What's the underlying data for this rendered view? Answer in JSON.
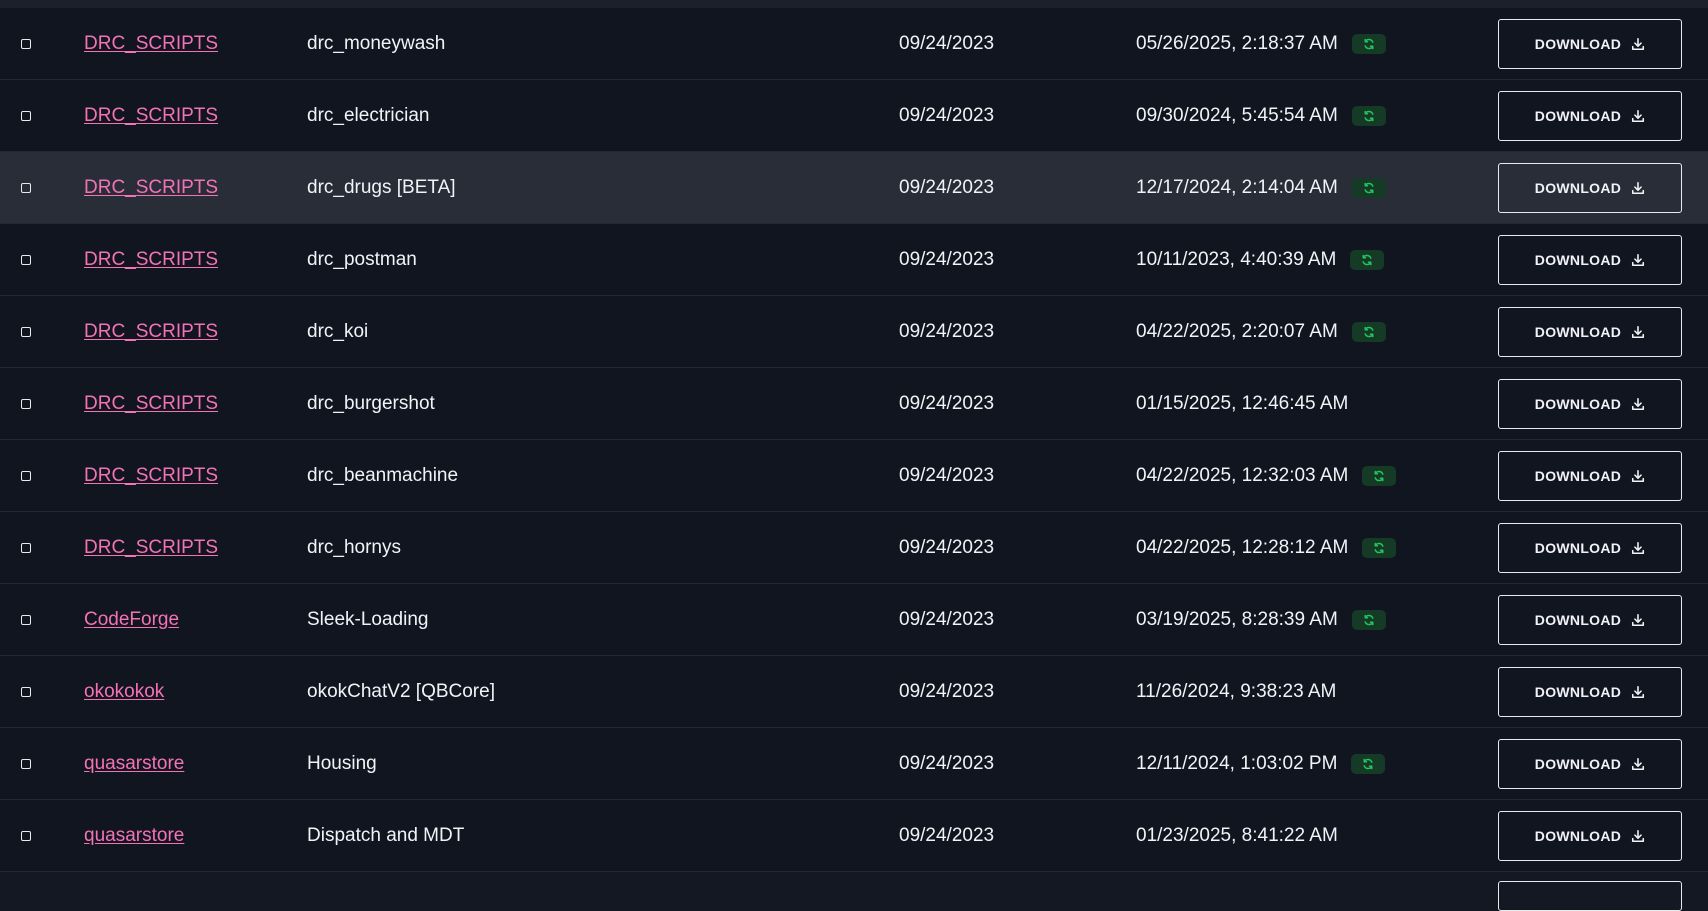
{
  "table": {
    "download_label": "DOWNLOAD",
    "rows": [
      {
        "author": "DRC_SCRIPTS",
        "name": "drc_moneywash",
        "created": "09/24/2023",
        "updated": "05/26/2025, 2:18:37 AM",
        "badge": true
      },
      {
        "author": "DRC_SCRIPTS",
        "name": "drc_electrician",
        "created": "09/24/2023",
        "updated": "09/30/2024, 5:45:54 AM",
        "badge": true
      },
      {
        "author": "DRC_SCRIPTS",
        "name": "drc_drugs [BETA]",
        "created": "09/24/2023",
        "updated": "12/17/2024, 2:14:04 AM",
        "badge": true,
        "hover": true
      },
      {
        "author": "DRC_SCRIPTS",
        "name": "drc_postman",
        "created": "09/24/2023",
        "updated": "10/11/2023, 4:40:39 AM",
        "badge": true
      },
      {
        "author": "DRC_SCRIPTS",
        "name": "drc_koi",
        "created": "09/24/2023",
        "updated": "04/22/2025, 2:20:07 AM",
        "badge": true
      },
      {
        "author": "DRC_SCRIPTS",
        "name": "drc_burgershot",
        "created": "09/24/2023",
        "updated": "01/15/2025, 12:46:45 AM",
        "badge": false
      },
      {
        "author": "DRC_SCRIPTS",
        "name": "drc_beanmachine",
        "created": "09/24/2023",
        "updated": "04/22/2025, 12:32:03 AM",
        "badge": true
      },
      {
        "author": "DRC_SCRIPTS",
        "name": "drc_hornys",
        "created": "09/24/2023",
        "updated": "04/22/2025, 12:28:12 AM",
        "badge": true
      },
      {
        "author": "CodeForge",
        "name": "Sleek-Loading",
        "created": "09/24/2023",
        "updated": "03/19/2025, 8:28:39 AM",
        "badge": true
      },
      {
        "author": "okokokok",
        "name": "okokChatV2 [QBCore]",
        "created": "09/24/2023",
        "updated": "11/26/2024, 9:38:23 AM",
        "badge": false
      },
      {
        "author": "quasarstore",
        "name": "Housing",
        "created": "09/24/2023",
        "updated": "12/11/2024, 1:03:02 PM",
        "badge": true
      },
      {
        "author": "quasarstore",
        "name": "Dispatch and MDT",
        "created": "09/24/2023",
        "updated": "01/23/2025, 8:41:22 AM",
        "badge": false
      }
    ]
  },
  "colors": {
    "background": "#111520",
    "row_hover": "#282d38",
    "author_link": "#f472b6",
    "badge_bg": "#153a26",
    "badge_icon": "#22c55e"
  },
  "icons": {
    "badge": "refresh-icon",
    "download": "download-icon"
  }
}
